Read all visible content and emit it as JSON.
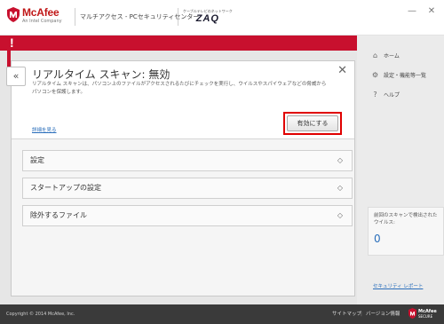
{
  "titlebar": {
    "brand_name": "McAfee",
    "brand_sub": "An Intel Company",
    "product_name": "マルチアクセス - PCセキュリティセンター",
    "partner_small": "ケーブルテレビのネットワーク",
    "partner_logo": "ZAQ",
    "minimize_icon": "minimize-icon",
    "close_icon": "close-icon"
  },
  "alert": {
    "mark": "!"
  },
  "panel": {
    "collapse_glyph": "«",
    "title": "リアルタイム スキャン: 無効",
    "close_glyph": "✕",
    "description": "リアルタイム スキャンは、パソコン上のファイルがアクセスされるたびにチェックを実行し、ウイルスやスパイウェアなどの脅威からパソコンを保護します。",
    "details_link": "詳細を見る",
    "enable_button": "有効にする",
    "accordions": [
      {
        "label": "設定",
        "icon": "◇"
      },
      {
        "label": "スタートアップの設定",
        "icon": "◇"
      },
      {
        "label": "除外するファイル",
        "icon": "◇"
      }
    ]
  },
  "sidebar": {
    "items": [
      {
        "label": "ホーム",
        "icon": "home-icon",
        "glyph": "⌂"
      },
      {
        "label": "設定・機能等一覧",
        "icon": "gear-icon",
        "glyph": "⚙"
      },
      {
        "label": "ヘルプ",
        "icon": "help-icon",
        "glyph": "?"
      }
    ],
    "scan_text": "前回のスキャンで検出されたウイルス:",
    "scan_count": "0",
    "security_link": "セキュリティ レポート"
  },
  "footer": {
    "copyright": "Copyright © 2014 McAfee, Inc.",
    "sitemap": "サイトマップ",
    "separator": "|",
    "version": "バージョン情報",
    "secure_line1": "McAfee",
    "secure_line2": "SECURE"
  },
  "colors": {
    "brand_red": "#c8102e",
    "link_blue": "#2a6ebb",
    "highlight_red": "#e00000"
  }
}
